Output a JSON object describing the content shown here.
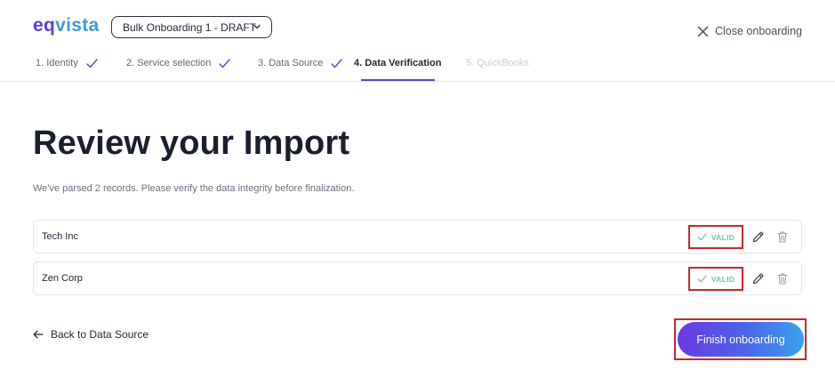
{
  "brand": {
    "name_part1": "eq",
    "name_part2": "vista"
  },
  "header": {
    "draft_select": "Bulk Onboarding 1 - DRAFT",
    "close_label": "Close onboarding"
  },
  "steps": [
    {
      "label": "1. Identity",
      "state": "done"
    },
    {
      "label": "2. Service selection",
      "state": "done"
    },
    {
      "label": "3. Data Source",
      "state": "done"
    },
    {
      "label": "4. Data Verification",
      "state": "active"
    },
    {
      "label": "5. QuickBooks",
      "state": "disabled"
    }
  ],
  "main": {
    "title": "Review your Import",
    "subtitle": "We've parsed 2 records. Please verify the data integrity before finalization."
  },
  "records": [
    {
      "name": "Tech Inc",
      "status": "VALID"
    },
    {
      "name": "Zen Corp",
      "status": "VALID"
    }
  ],
  "footer": {
    "back_label": "Back to Data Source",
    "finish_label": "Finish onboarding"
  },
  "colors": {
    "brand_purple": "#5b3fd6",
    "brand_blue": "#3a9be0",
    "valid_green": "#6cc7a3",
    "highlight_red": "#c62828"
  }
}
